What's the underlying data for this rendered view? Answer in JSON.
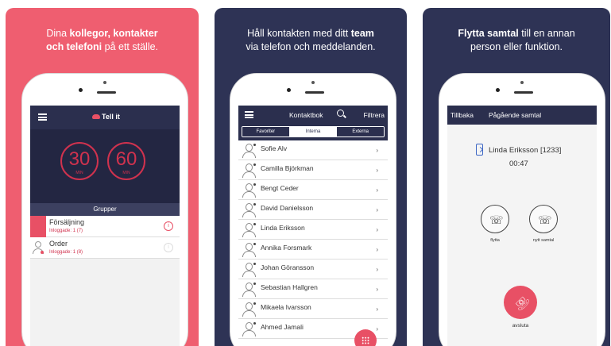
{
  "colors": {
    "panel_pink": "#ef5e70",
    "panel_navy": "#2e3355",
    "accent_red": "#e85065",
    "header_navy": "#2b2f4e"
  },
  "panel1": {
    "caption_parts": [
      "Dina ",
      "kollegor, kontakter",
      "och telefoni",
      " på ett ställe."
    ],
    "app_logo": "Tell it",
    "timer_a": {
      "value": "30",
      "unit": "MIN"
    },
    "timer_b": {
      "value": "60",
      "unit": "MIN"
    },
    "groups_heading": "Grupper",
    "groups": [
      {
        "name": "Försäljning",
        "status": "Inloggade: 1 (7)",
        "info": "i"
      },
      {
        "name": "Order",
        "status": "Inloggade: 1 (8)",
        "info": "i"
      }
    ]
  },
  "panel2": {
    "caption_parts": [
      "Håll kontakten med ditt ",
      "team",
      "via telefon och meddelanden."
    ],
    "header_title": "Kontaktbok",
    "filter_label": "Filtrera",
    "segments": [
      "Favoriter",
      "Interna",
      "Externa"
    ],
    "chevron": "›",
    "contacts": [
      "Sofie Alv",
      "Camilla Björkman",
      "Bengt Ceder",
      "David Danielsson",
      "Linda Eriksson",
      "Annika Forsmark",
      "Johan Göransson",
      "Sebastian Hallgren",
      "Mikaela Ivarsson",
      "Ahmed Jamali"
    ]
  },
  "panel3": {
    "caption_parts": [
      "Flytta samtal",
      " till en annan",
      "person eller funktion."
    ],
    "back_label": "Tillbaka",
    "header_title": "Pågående samtal",
    "caller": "Linda Eriksson [1233]",
    "duration": "00:47",
    "actions": [
      {
        "label": "flytta",
        "icon": "☏"
      },
      {
        "label": "nytt samtal",
        "icon": "☏"
      }
    ],
    "hangup_label": "avsluta",
    "hangup_icon": "☏"
  }
}
